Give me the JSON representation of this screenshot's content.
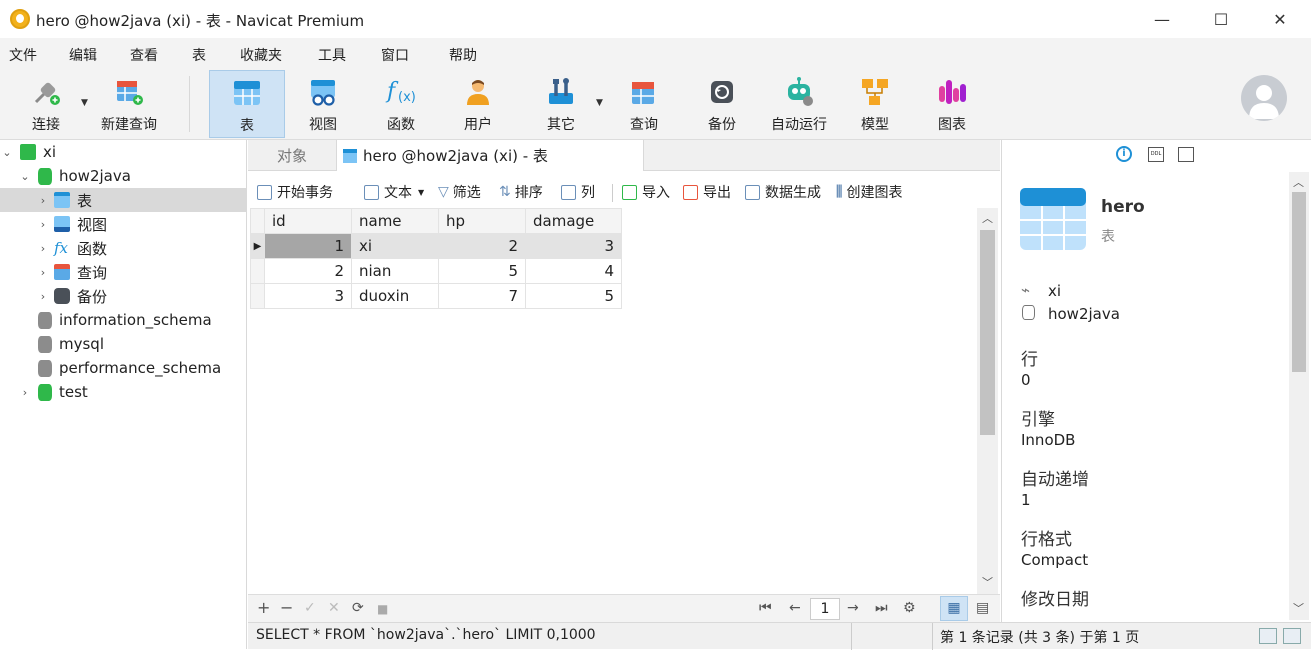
{
  "window": {
    "title": "hero @how2java (xi) - 表 - Navicat Premium",
    "minimize": "—",
    "maximize": "☐",
    "close": "✕"
  },
  "menu": [
    "文件",
    "编辑",
    "查看",
    "表",
    "收藏夹",
    "工具",
    "窗口",
    "帮助"
  ],
  "toolbar": [
    {
      "label": "连接",
      "icon": "plug-icon"
    },
    {
      "label": "新建查询",
      "icon": "new-query-icon"
    },
    {
      "label": "表",
      "icon": "table-icon"
    },
    {
      "label": "视图",
      "icon": "view-icon"
    },
    {
      "label": "函数",
      "icon": "function-icon"
    },
    {
      "label": "用户",
      "icon": "user-icon"
    },
    {
      "label": "其它",
      "icon": "tools-icon"
    },
    {
      "label": "查询",
      "icon": "query-icon"
    },
    {
      "label": "备份",
      "icon": "backup-icon"
    },
    {
      "label": "自动运行",
      "icon": "robot-icon"
    },
    {
      "label": "模型",
      "icon": "model-icon"
    },
    {
      "label": "图表",
      "icon": "chart-icon"
    }
  ],
  "tree": {
    "connection": "xi",
    "database": "how2java",
    "children": [
      "表",
      "视图",
      "函数",
      "查询",
      "备份"
    ],
    "others": [
      "information_schema",
      "mysql",
      "performance_schema",
      "test"
    ]
  },
  "tabs": {
    "objects": "对象",
    "active": "hero @how2java (xi) - 表"
  },
  "subtoolbar": [
    "开始事务",
    "文本",
    "筛选",
    "排序",
    "列",
    "导入",
    "导出",
    "数据生成",
    "创建图表"
  ],
  "grid": {
    "columns": [
      "id",
      "name",
      "hp",
      "damage"
    ],
    "rows": [
      [
        "1",
        "xi",
        "2",
        "3"
      ],
      [
        "2",
        "nian",
        "5",
        "4"
      ],
      [
        "3",
        "duoxin",
        "7",
        "5"
      ]
    ]
  },
  "bottombar": {
    "add": "+",
    "remove": "−",
    "apply": "✓",
    "discard": "✕",
    "refresh": "⟳",
    "stop": "■",
    "page": "1"
  },
  "status": {
    "sql": "SELECT * FROM `how2java`.`hero` LIMIT 0,1000",
    "records": "第 1 条记录 (共 3 条) 于第 1 页"
  },
  "info": {
    "name": "hero",
    "type": "表",
    "connection": "xi",
    "database": "how2java",
    "fields": [
      {
        "label": "行",
        "value": "0"
      },
      {
        "label": "引擎",
        "value": "InnoDB"
      },
      {
        "label": "自动递增",
        "value": "1"
      },
      {
        "label": "行格式",
        "value": "Compact"
      },
      {
        "label": "修改日期",
        "value": ""
      }
    ]
  },
  "colors": {
    "accent": "#1e90d6",
    "selection": "#cfe3f5"
  }
}
